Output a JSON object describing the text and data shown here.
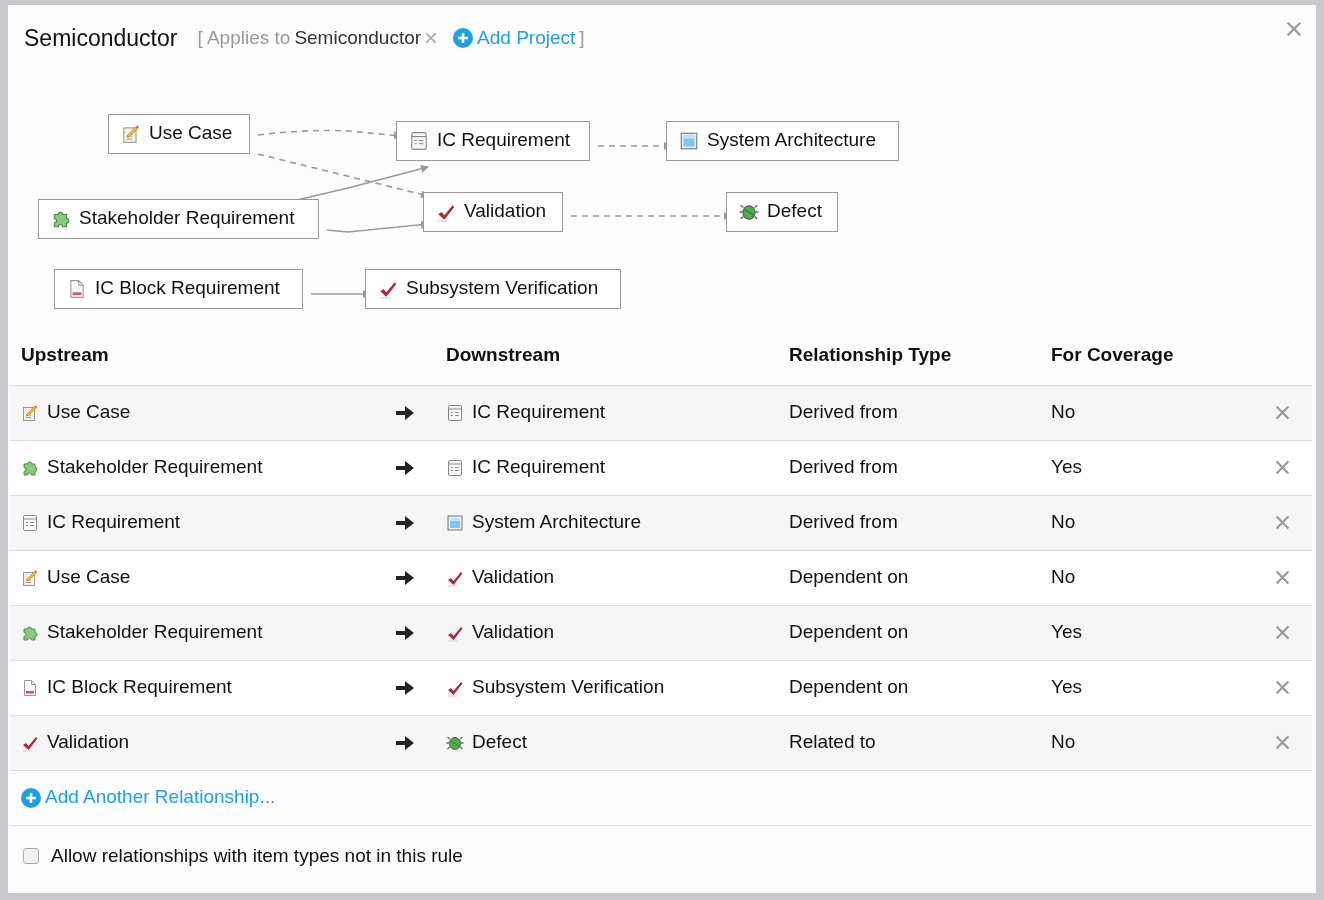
{
  "header": {
    "title": "Semiconductor",
    "applies_label": "[ Applies to",
    "project": "Semiconductor",
    "add_project": "Add Project",
    "closing_bracket": "]"
  },
  "diagram": {
    "nodes": [
      {
        "label": "Use Case",
        "kind": "usecase"
      },
      {
        "label": "IC Requirement",
        "kind": "requirement"
      },
      {
        "label": "System Architecture",
        "kind": "architecture"
      },
      {
        "label": "Stakeholder Requirement",
        "kind": "stakeholder"
      },
      {
        "label": "Validation",
        "kind": "validation"
      },
      {
        "label": "Defect",
        "kind": "defect"
      },
      {
        "label": "IC Block Requirement",
        "kind": "document"
      },
      {
        "label": "Subsystem Verification",
        "kind": "validation"
      }
    ]
  },
  "table": {
    "columns": [
      "Upstream",
      "Downstream",
      "Relationship Type",
      "For Coverage"
    ],
    "rows": [
      {
        "upstream": {
          "label": "Use Case",
          "kind": "usecase"
        },
        "downstream": {
          "label": "IC Requirement",
          "kind": "requirement"
        },
        "type": "Derived from",
        "coverage": "No"
      },
      {
        "upstream": {
          "label": "Stakeholder Requirement",
          "kind": "stakeholder"
        },
        "downstream": {
          "label": "IC Requirement",
          "kind": "requirement"
        },
        "type": "Derived from",
        "coverage": "Yes"
      },
      {
        "upstream": {
          "label": "IC Requirement",
          "kind": "requirement"
        },
        "downstream": {
          "label": "System Architecture",
          "kind": "architecture"
        },
        "type": "Derived from",
        "coverage": "No"
      },
      {
        "upstream": {
          "label": "Use Case",
          "kind": "usecase"
        },
        "downstream": {
          "label": "Validation",
          "kind": "validation"
        },
        "type": "Dependent on",
        "coverage": "No"
      },
      {
        "upstream": {
          "label": "Stakeholder Requirement",
          "kind": "stakeholder"
        },
        "downstream": {
          "label": "Validation",
          "kind": "validation"
        },
        "type": "Dependent on",
        "coverage": "Yes"
      },
      {
        "upstream": {
          "label": "IC Block Requirement",
          "kind": "document"
        },
        "downstream": {
          "label": "Subsystem Verification",
          "kind": "validation"
        },
        "type": "Dependent on",
        "coverage": "Yes"
      },
      {
        "upstream": {
          "label": "Validation",
          "kind": "validation"
        },
        "downstream": {
          "label": "Defect",
          "kind": "defect"
        },
        "type": "Related to",
        "coverage": "No"
      }
    ],
    "add_link": "Add Another Relationship..."
  },
  "allow_option": {
    "label": "Allow relationships with item types not in this rule",
    "checked": false
  }
}
